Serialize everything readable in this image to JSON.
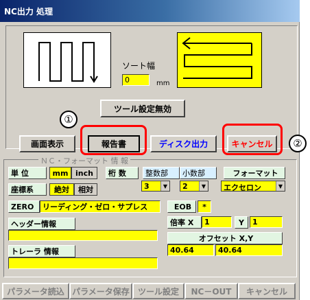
{
  "window": {
    "title": "NC出力 処理"
  },
  "preview": {
    "sort_width_label": "ソート幅",
    "sort_width_value": "0",
    "unit_label": "mm"
  },
  "buttons": {
    "tool_setting_disable": "ツール設定無効",
    "screen_display": "画面表示",
    "report": "報告書",
    "disk_output": "ディスク出力",
    "cancel": "キャンセル"
  },
  "callouts": {
    "one": "①",
    "two": "②"
  },
  "format_section": {
    "legend": "ＮＣ・フォーマット 情 報",
    "unit": {
      "label": "単 位",
      "options": [
        "mm",
        "inch"
      ],
      "selected": "mm"
    },
    "digits": {
      "label": "桁 数",
      "integer_label": "整数部",
      "decimal_label": "小数部",
      "integer_value": "3",
      "decimal_value": "2"
    },
    "format": {
      "label": "フォーマット",
      "value": "エクセロン"
    },
    "coord": {
      "label": "座標系",
      "options": [
        "絶対",
        "相対"
      ],
      "selected": "絶対"
    },
    "zero": {
      "label": "ZERO",
      "value": "リーディング・ゼロ・サプレス"
    },
    "eob": {
      "label": "EOB",
      "value": "*"
    },
    "header_info": {
      "label": "ヘッダー情報",
      "value": ""
    },
    "scale": {
      "label": "倍率 X",
      "x_value": "1",
      "y_label": "Y",
      "y_value": "1"
    },
    "offset": {
      "label": "オフセット X,Y",
      "x_value": "40.64",
      "y_value": "40.64"
    },
    "trailer_info": {
      "label": "トレーラ 情報",
      "value": ""
    }
  },
  "bottom_bar": [
    "パラメータ読込",
    "パラメータ保存",
    "ツール設定",
    "NC－OUT",
    "キャンセル"
  ],
  "colors": {
    "field": "#ffff00",
    "label_bg": "#e2f5e2",
    "highlight": "#ff0000",
    "disk_text": "#0000ff"
  }
}
